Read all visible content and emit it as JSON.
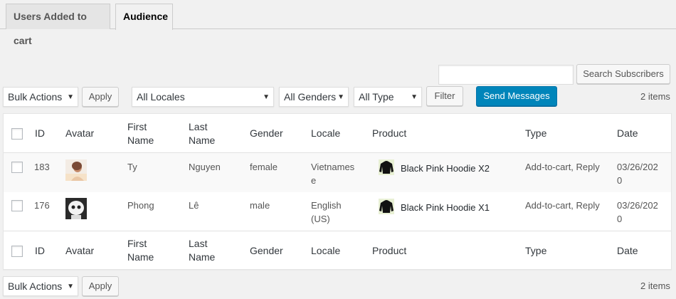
{
  "tabs": [
    {
      "label": "Users Added to cart",
      "active": false
    },
    {
      "label": "Audience",
      "active": true
    }
  ],
  "search": {
    "placeholder": "",
    "button_label": "Search Subscribers"
  },
  "top_actions": {
    "bulk_actions": "Bulk Actions",
    "apply": "Apply",
    "locales": "All Locales",
    "genders": "All Genders",
    "type": "All Type",
    "filter": "Filter",
    "send": "Send Messages",
    "count": "2 items"
  },
  "columns": {
    "id": "ID",
    "avatar": "Avatar",
    "first_name": [
      "First",
      "Name"
    ],
    "last_name": [
      "Last",
      "Name"
    ],
    "gender": "Gender",
    "locale": "Locale",
    "product": "Product",
    "type": "Type",
    "date": "Date"
  },
  "rows": [
    {
      "id": "183",
      "first_name": "Ty",
      "last_name": "Nguyen",
      "gender": "female",
      "locale": [
        "Vietnames",
        "e"
      ],
      "product": "Black Pink Hoodie X2",
      "type": "Add-to-cart, Reply",
      "date": [
        "03/26/202",
        "0"
      ]
    },
    {
      "id": "176",
      "first_name": "Phong",
      "last_name": "Lê",
      "gender": "male",
      "locale": [
        "English",
        "(US)"
      ],
      "product": "Black Pink Hoodie X1",
      "type": "Add-to-cart, Reply",
      "date": [
        "03/26/202",
        "0"
      ]
    }
  ],
  "bottom_actions": {
    "bulk_actions": "Bulk Actions",
    "apply": "Apply",
    "count": "2 items"
  },
  "colors": {
    "primary": "#0085ba",
    "background": "#f1f1f1"
  }
}
